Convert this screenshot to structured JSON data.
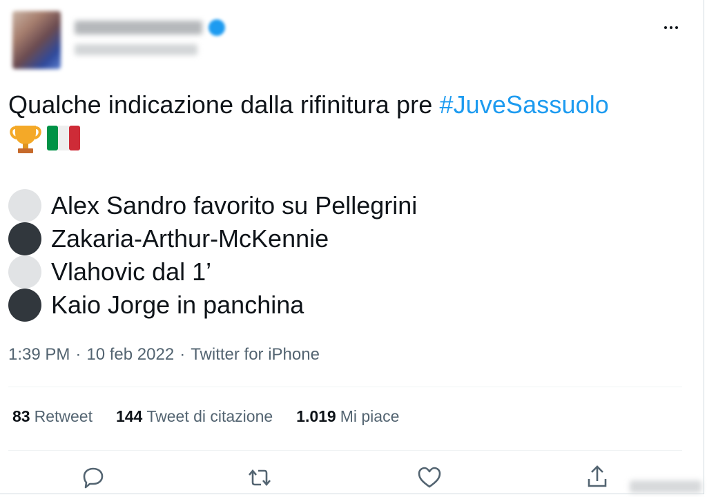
{
  "header": {
    "more_icon": "more-horizontal-icon"
  },
  "tweet": {
    "text": "Qualche indicazione dalla rifinitura pre ",
    "hashtag": "#JuveSassuolo",
    "emojis": [
      "trophy-emoji",
      "italy-flag-emoji"
    ],
    "lines": [
      {
        "marker": "white-circle",
        "text": "Alex Sandro favorito su Pellegrini"
      },
      {
        "marker": "black-circle",
        "text": "Zakaria-Arthur-McKennie"
      },
      {
        "marker": "white-circle",
        "text": "Vlahovic dal 1’"
      },
      {
        "marker": "black-circle",
        "text": "Kaio Jorge in panchina"
      }
    ],
    "time": "1:39 PM",
    "separator": "·",
    "date": "10 feb 2022",
    "source": "Twitter for iPhone"
  },
  "stats": {
    "retweets_count": "83",
    "retweets_label": "Retweet",
    "quotes_count": "144",
    "quotes_label": "Tweet di citazione",
    "likes_count": "1.019",
    "likes_label": "Mi piace"
  },
  "actions": {
    "reply_icon": "reply-icon",
    "retweet_icon": "retweet-icon",
    "like_icon": "heart-icon",
    "share_icon": "share-icon"
  },
  "colors": {
    "accent": "#1d9bf0",
    "text": "#0f1419",
    "secondary": "#536471"
  }
}
